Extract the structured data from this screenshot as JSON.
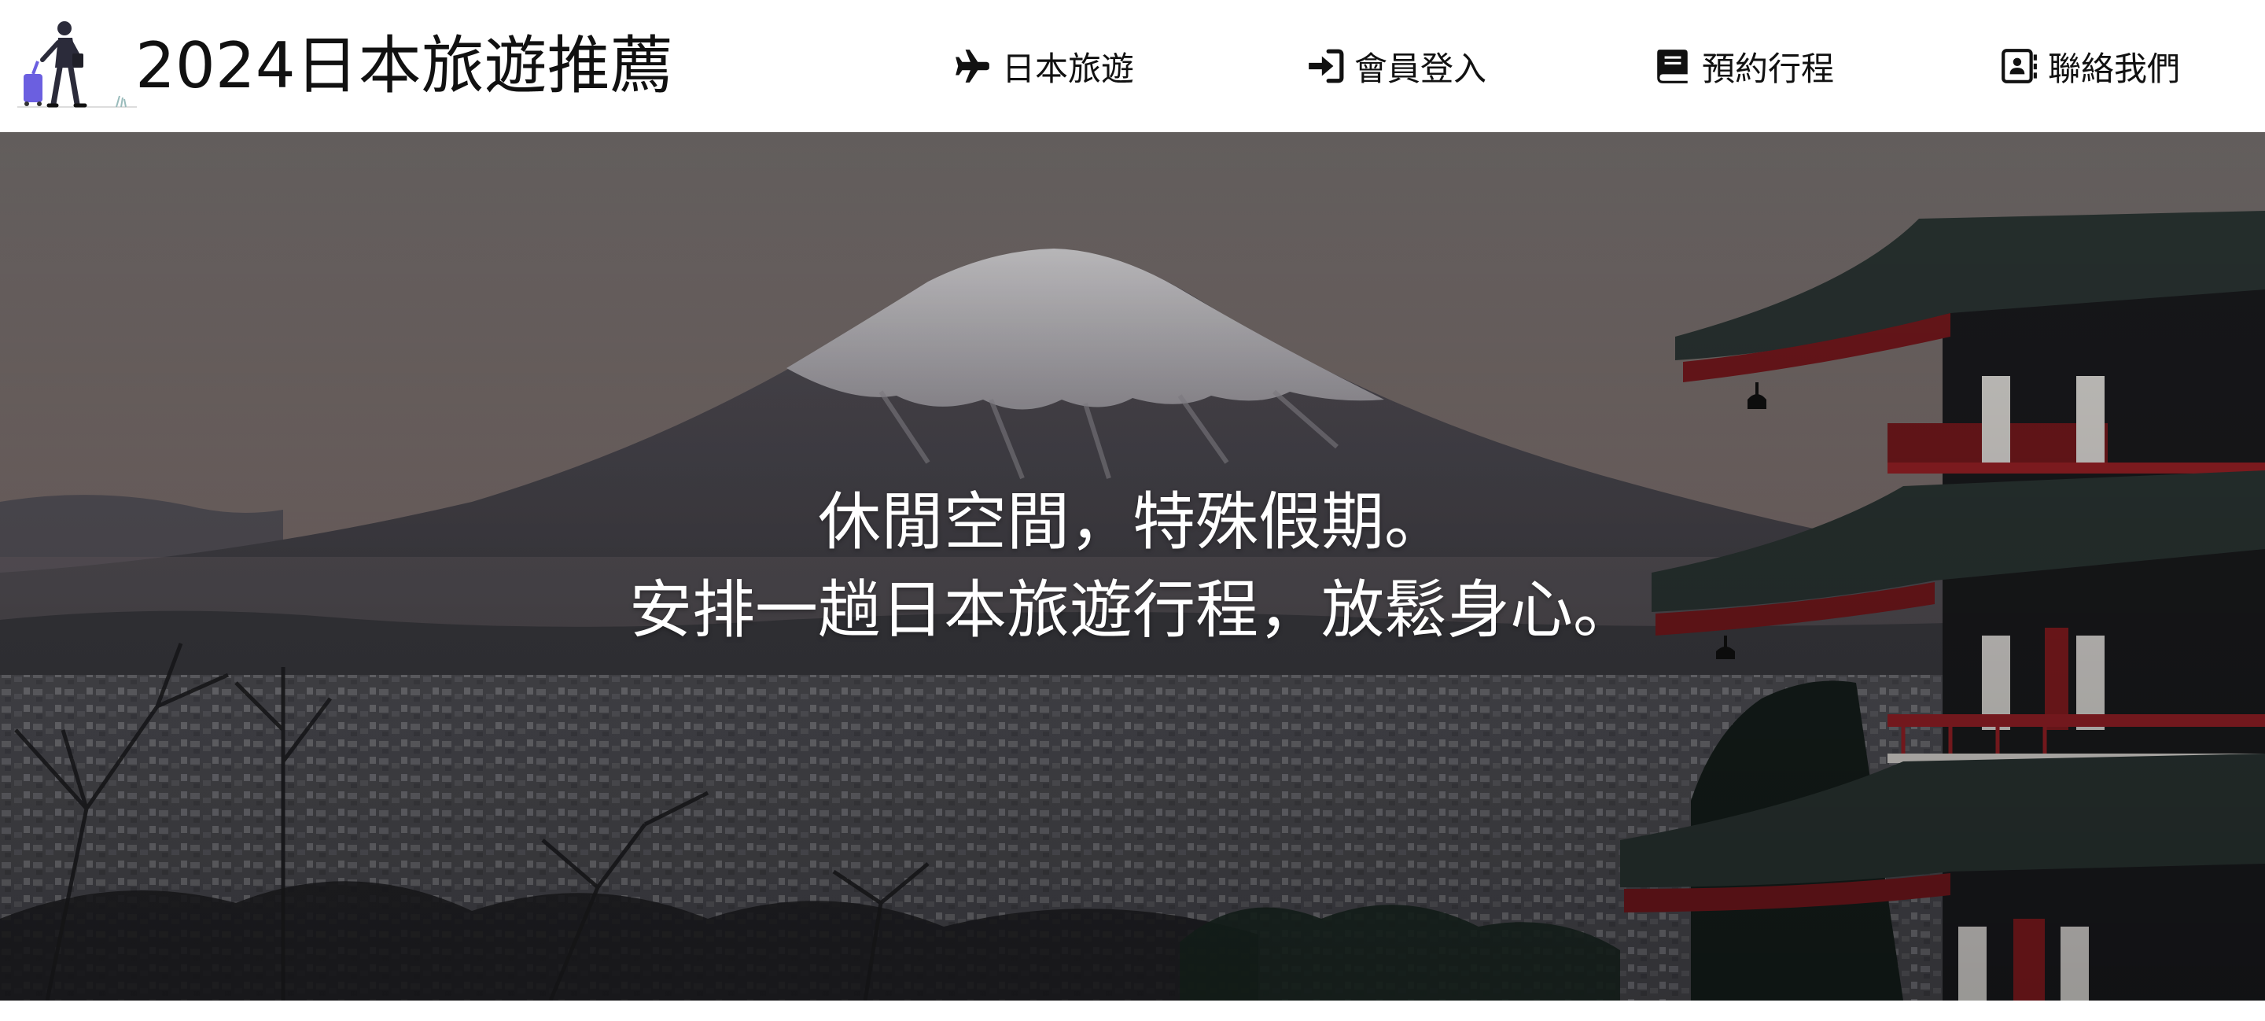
{
  "header": {
    "title": "2024日本旅遊推薦",
    "logo_icon": "traveler-with-suitcase-icon"
  },
  "nav": [
    {
      "label": "日本旅遊",
      "icon": "airplane-icon"
    },
    {
      "label": "會員登入",
      "icon": "sign-in-icon"
    },
    {
      "label": "預約行程",
      "icon": "book-icon"
    },
    {
      "label": "聯絡我們",
      "icon": "contact-card-icon"
    }
  ],
  "hero": {
    "line1": "休閒空間，特殊假期。",
    "line2": "安排一趟日本旅遊行程，放鬆身心。"
  },
  "colors": {
    "sky_top": "#7a7275",
    "sky_bottom": "#8c7a78",
    "mountain": "#4b4950",
    "snow": "#d9d7da",
    "city": "#5a5a60",
    "pagoda_red": "#8d1d22",
    "pagoda_roof": "#2f3a38",
    "text": "#ffffff",
    "suitcase": "#6b5fe0"
  }
}
